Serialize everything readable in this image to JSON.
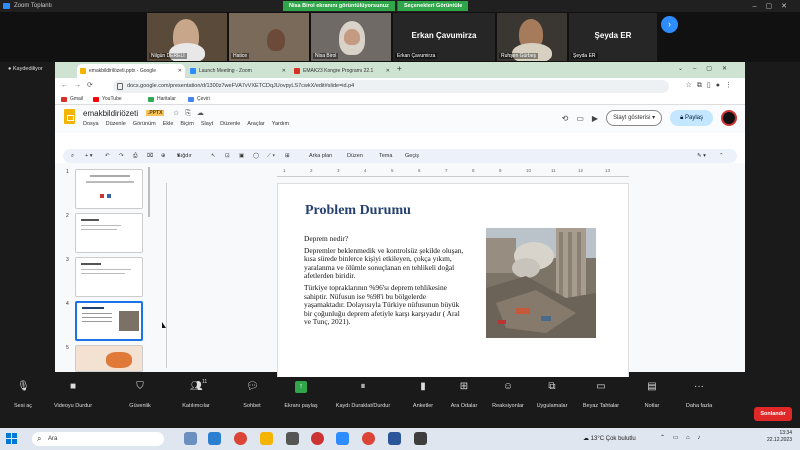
{
  "zoom": {
    "window_title": "Zoom Toplantı",
    "share_notice": "Nisa Birol ekranını görüntülüyorsunuz",
    "view_options": "Seçenekleri Görüntüle",
    "participants": [
      {
        "name": "Nilgün DERELİ"
      },
      {
        "name": "Hatice"
      },
      {
        "name": "Nisa Birol"
      },
      {
        "name": "Erkan Çavumirza",
        "big": "Erkan Çavumirza"
      },
      {
        "name": "Ruhşen Gürbeş"
      },
      {
        "name": "Şeyda ER",
        "big": "Şeyda ER"
      }
    ],
    "recording_label": "Kaydediliyor",
    "controls": [
      {
        "label": "Sesi aç",
        "icon": "mic-muted-icon"
      },
      {
        "label": "Videoyu Durdur",
        "icon": "video-icon"
      },
      {
        "label": "Güvenlik",
        "icon": "shield-icon"
      },
      {
        "label": "Katılımcılar",
        "icon": "participants-icon",
        "count": "11"
      },
      {
        "label": "Sohbet",
        "icon": "chat-icon"
      },
      {
        "label": "Ekranı paylaş",
        "icon": "share-screen-icon"
      },
      {
        "label": "Kaydı Duraklat/Durdur",
        "icon": "pause-record-icon"
      },
      {
        "label": "Anketler",
        "icon": "polls-icon"
      },
      {
        "label": "Ara Odalar",
        "icon": "breakout-icon"
      },
      {
        "label": "Reaksiyonlar",
        "icon": "reactions-icon"
      },
      {
        "label": "Uygulamalar",
        "icon": "apps-icon"
      },
      {
        "label": "Beyaz Tahtalar",
        "icon": "whiteboard-icon"
      },
      {
        "label": "Notlar",
        "icon": "notes-icon"
      },
      {
        "label": "Daha fazla",
        "icon": "more-icon"
      }
    ],
    "end_button": "Sonlandır"
  },
  "browser": {
    "tabs": [
      {
        "title": "emakbildirilözeti.pptx - Google",
        "color": "#f4b400"
      },
      {
        "title": "Launch Meeting - Zoom",
        "color": "#2d8cff"
      },
      {
        "title": "EMAK23 Kongre Programı 22.1",
        "color": "#d93025"
      }
    ],
    "new_tab": "+",
    "url": "docs.google.com/presentation/d/1300z7weFVA7vVXETCDqJUovpyLS7cwkX/edit#slide=id.p4",
    "bookmarks": [
      {
        "label": "Gmail",
        "color": "#d93025"
      },
      {
        "label": "YouTube",
        "color": "#ff0000"
      },
      {
        "label": "Haritalar",
        "color": "#34a853"
      },
      {
        "label": "Çeviri",
        "color": "#4285f4"
      }
    ]
  },
  "slides_app": {
    "doc_title": "emakbildiriözeti",
    "badge": ".PPTX",
    "menus": [
      "Dosya",
      "Düzenle",
      "Görünüm",
      "Ekle",
      "Biçim",
      "Slayt",
      "Düzenle",
      "Araçlar",
      "Yardım"
    ],
    "slideshow_button": "Slayt gösterisi",
    "share_button": "Paylaş",
    "toolbar": {
      "fit": "Sığdır",
      "background": "Arka plan",
      "layout": "Düzen",
      "theme": "Tema",
      "transition": "Geçiş"
    },
    "ruler_ticks": [
      "1",
      "2",
      "3",
      "4",
      "5",
      "6",
      "7",
      "8",
      "9",
      "10",
      "11",
      "12",
      "13"
    ],
    "thumbnails": [
      "1",
      "2",
      "3",
      "4",
      "5"
    ],
    "selected_thumbnail": 4
  },
  "slide": {
    "title": "Problem Durumu",
    "question": "Deprem nedir?",
    "para1": "Depremler beklenmedik ve kontrolsüz şekilde oluşan, kısa sürede binlerce kişiyi etkileyen, çokça yıkım, yaralanma ve ölümle sonuçlanan en tehlikeli doğal afetlerden biridir.",
    "para2": "Türkiye topraklarının %96'sı deprem tehlikesine sahiptir. Nüfusun ise %98'i bu bölgelerde yaşamaktadır. Dolayısıyla Türkiye nüfusunun büyük bir çoğunluğu deprem afetiyle karşı karşıyadır ( Aral ve Tunç, 2021)."
  },
  "taskbar": {
    "search": "Ara",
    "weather": "13°C  Çok bulutlu",
    "time": "13:34",
    "date": "22.12.2023"
  }
}
